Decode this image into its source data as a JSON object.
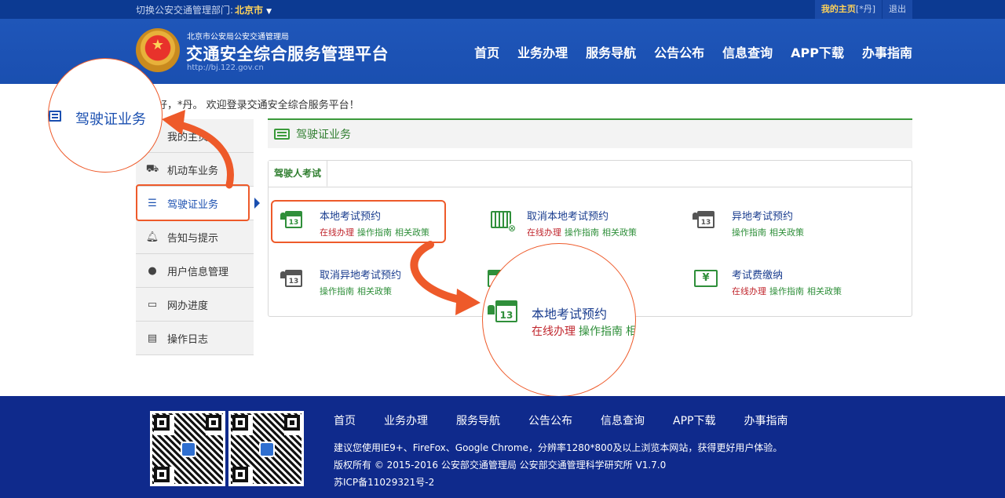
{
  "topbar": {
    "dept_label": "切换公安交通管理部门:",
    "city": "北京市",
    "my_home": "我的主页",
    "user_suffix": "[*丹]",
    "logout": "退出"
  },
  "header": {
    "org": "北京市公安局公安交通管理局",
    "title": "交通安全综合服务管理平台",
    "url": "http://bj.122.gov.cn",
    "nav": [
      "首页",
      "业务办理",
      "服务导航",
      "公告公布",
      "信息查询",
      "APP下载",
      "办事指南"
    ]
  },
  "welcome": "好，*丹。 欢迎登录交通安全综合服务平台！",
  "sidebar": {
    "items": [
      {
        "label": "我的主页",
        "icon": "home-icon"
      },
      {
        "label": "机动车业务",
        "icon": "truck-icon"
      },
      {
        "label": "驾驶证业务",
        "icon": "list-icon",
        "active": true
      },
      {
        "label": "告知与提示",
        "icon": "bell-icon"
      },
      {
        "label": "用户信息管理",
        "icon": "user-icon"
      },
      {
        "label": "网办进度",
        "icon": "progress-icon"
      },
      {
        "label": "操作日志",
        "icon": "log-icon"
      }
    ]
  },
  "main": {
    "section_title": "驾驶证业务",
    "tab": "驾驶人考试",
    "services": [
      {
        "title": "本地考试预约",
        "online": "在线办理",
        "guide": "操作指南",
        "policy": "相关政策",
        "icon": "calendar-13-icon"
      },
      {
        "title": "取消本地考试预约",
        "online": "在线办理",
        "guide": "操作指南",
        "policy": "相关政策",
        "icon": "calendar-cancel-icon"
      },
      {
        "title": "异地考试预约",
        "guide": "操作指南",
        "policy": "相关政策",
        "icon": "calendar-13-icon"
      },
      {
        "title": "取消异地考试预约",
        "guide": "操作指南",
        "policy": "相关政策",
        "icon": "calendar-13-icon"
      },
      {
        "title": "",
        "guide": "",
        "policy": "",
        "icon": "calendar-icon"
      },
      {
        "title": "考试费缴纳",
        "online": "在线办理",
        "guide": "操作指南",
        "policy": "相关政策",
        "icon": "yen-payment-icon"
      }
    ]
  },
  "zoom": {
    "left_text": "驾驶证业务",
    "right_title": "本地考试预约",
    "right_online": "在线办理",
    "right_guide": "操作指南",
    "right_more": "相"
  },
  "footer": {
    "nav": [
      "首页",
      "业务办理",
      "服务导航",
      "公告公布",
      "信息查询",
      "APP下载",
      "办事指南"
    ],
    "browser_note": "建议您使用IE9+、FireFox、Google Chrome，分辨率1280*800及以上浏览本网站，获得更好用户体验。",
    "copyright": "版权所有 © 2015-2016 公安部交通管理局 公安部交通管理科学研究所 V1.7.0",
    "icp": "苏ICP备11029321号-2"
  },
  "colors": {
    "brand_blue": "#1a4fb0",
    "footer_blue": "#0f2a8c",
    "accent_green": "#2f8f3a",
    "link_red": "#c0262d",
    "highlight_orange": "#ee5a2a"
  }
}
